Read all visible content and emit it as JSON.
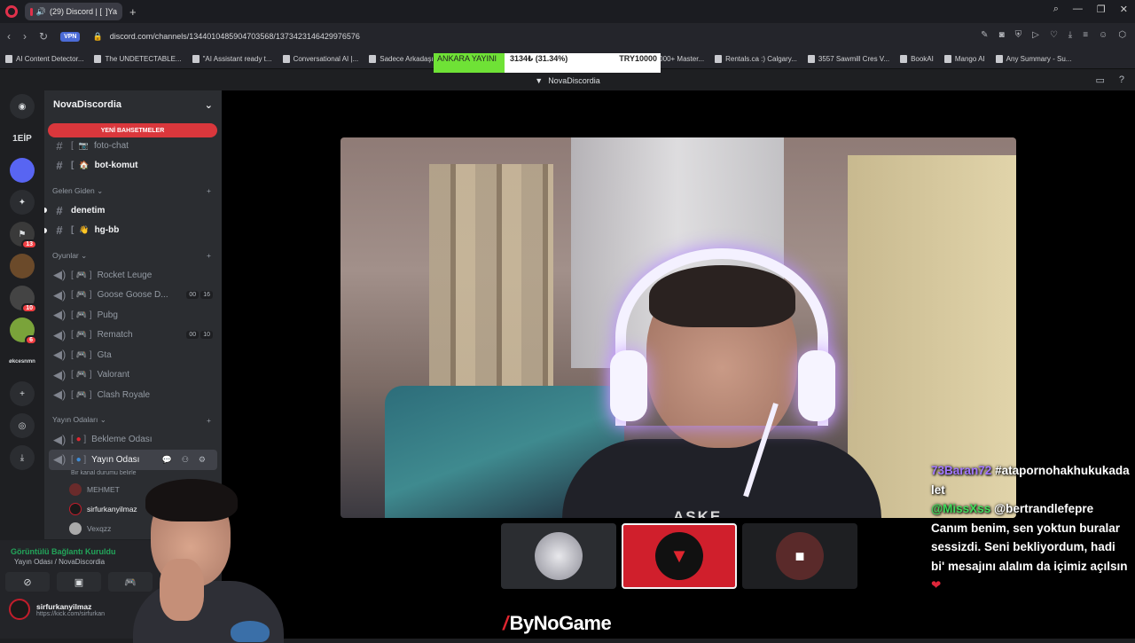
{
  "browser": {
    "tab_title": "(29) Discord | [  ]Ya",
    "url": "discord.com/channels/1344010485904703568/1373423146429976576",
    "vpn_label": "VPN",
    "bookmarks": [
      "AI Content Detector...",
      "The UNDETECTABLE...",
      "\"AI Assistant ready t...",
      "Conversational AI |...",
      "Sadece Arkadaşız",
      "5000+ Master...",
      "Rentals.ca :) Calgary...",
      "3557 Sawmill Cres V...",
      "BookAI",
      "Mango AI",
      "Any Summary - Su..."
    ]
  },
  "ticker": {
    "a": "ANKARA YAYINI",
    "b": "3134₺ (31.34%)",
    "c": "TRY10000"
  },
  "discord": {
    "window_title": "NovaDiscordia",
    "server_name": "NovaDiscordia",
    "mention_pill": "YENİ BAHSETMELER",
    "guild_labels": {
      "g1": "1EİP",
      "g_badge_1": "13",
      "g_badge_2": "10",
      "g_badge_3": "6",
      "g_txt": "økcesnmn"
    },
    "top_channels": [
      {
        "name": "foto-chat",
        "emoji": "📷"
      },
      {
        "name": "bot-komut",
        "emoji": "🏠"
      }
    ],
    "cat1": "Gelen Giden",
    "cat1_channels": [
      {
        "name": "denetim"
      },
      {
        "name": "hg-bb",
        "emoji": "👋"
      }
    ],
    "cat2": "Oyunlar",
    "voice_games": [
      {
        "name": "Rocket Leuge",
        "c1": "",
        "c2": ""
      },
      {
        "name": "Goose Goose D...",
        "c1": "00",
        "c2": "16"
      },
      {
        "name": "Pubg",
        "c1": "",
        "c2": ""
      },
      {
        "name": "Rematch",
        "c1": "00",
        "c2": "10"
      },
      {
        "name": "Gta",
        "c1": "",
        "c2": ""
      },
      {
        "name": "Valorant",
        "c1": "",
        "c2": ""
      },
      {
        "name": "Clash Royale",
        "c1": "",
        "c2": ""
      }
    ],
    "cat3": "Yayın Odaları",
    "stream_rooms": [
      {
        "name": "Bekleme Odası"
      },
      {
        "name": "Yayın Odası"
      }
    ],
    "room_status": "Bir kanal durumu belirle",
    "voice_users": [
      "MEHMET",
      "sirfurkanyilmaz",
      "Vexqzz"
    ],
    "voice_panel": {
      "title": "Görüntülü Bağlantı Kuruldu",
      "sub": "Yayın Odası / NovaDiscordia"
    },
    "user": {
      "name": "sirfurkanyilmaz",
      "sub": "https://kick.com/sirfurkan"
    }
  },
  "stream": {
    "shirt_text": "ASKE",
    "brand": "ByNoGame",
    "brand_slash": "/"
  },
  "chat": [
    {
      "user": "73Baran72",
      "user_class": "u1",
      "text": "#atapornohakhukukadalet"
    },
    {
      "user": "@MissXss",
      "user_class": "u2",
      "text": "@bertrandlefepre Canım benim, sen yoktun buralar sessizdi. Seni bekliyordum, hadi bi' mesajını alalım da içimiz açılsın"
    }
  ],
  "colors": {
    "accent_red": "#da373c",
    "online_green": "#23a55a",
    "chat_user_purple": "#a277ff",
    "chat_user_green": "#3fdc5a"
  }
}
